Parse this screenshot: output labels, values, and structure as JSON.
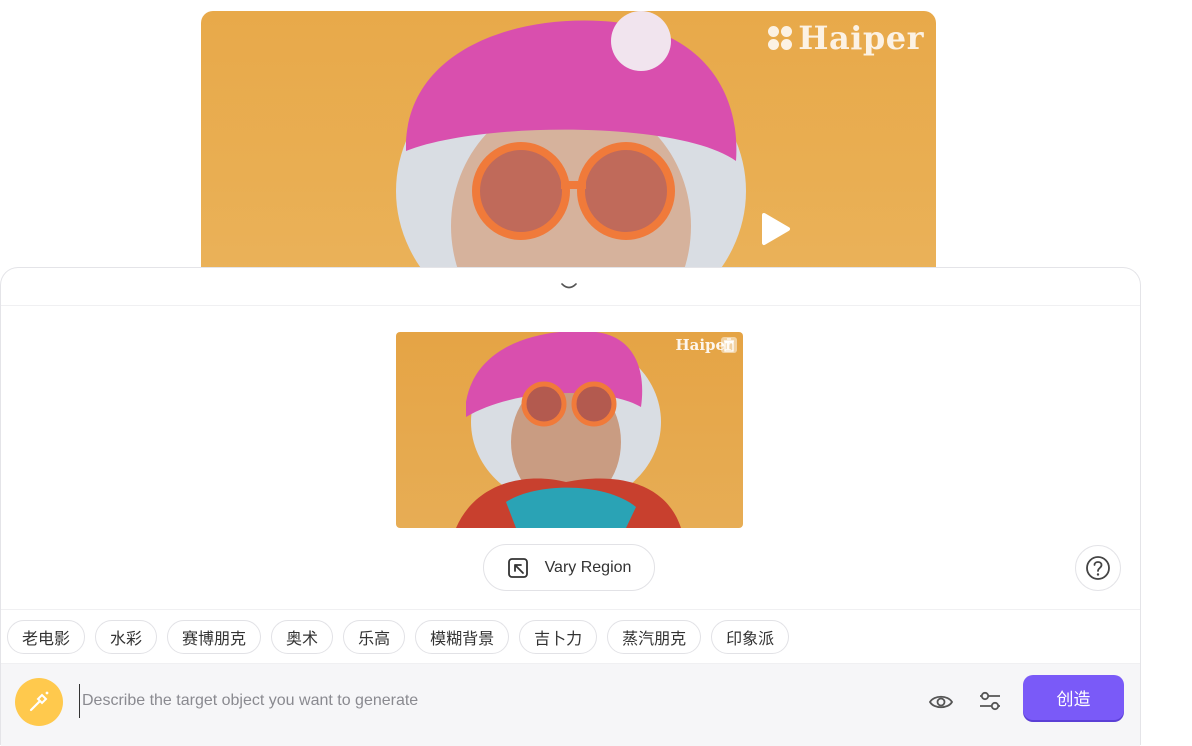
{
  "preview": {
    "watermark": "Haiper",
    "play_icon": "play-icon"
  },
  "panel": {
    "collapse_icon": "chevron-down-icon",
    "thumbnail_watermark": "Haiper",
    "thumbnail_delete_icon": "trash-icon",
    "vary_region_label": "Vary Region",
    "vary_region_icon": "region-select-icon",
    "help_icon": "question-icon"
  },
  "styles": [
    {
      "label": "老电影"
    },
    {
      "label": "水彩"
    },
    {
      "label": "赛博朋克"
    },
    {
      "label": "奥术"
    },
    {
      "label": "乐高"
    },
    {
      "label": "模糊背景"
    },
    {
      "label": "吉卜力"
    },
    {
      "label": "蒸汽朋克"
    },
    {
      "label": "印象派"
    }
  ],
  "input": {
    "placeholder": "Describe the target object you want to generate",
    "value": "",
    "magic_icon": "magic-wand-icon",
    "eye_icon": "eye-icon",
    "settings_icon": "sliders-icon",
    "create_label": "创造"
  },
  "colors": {
    "accent": "#7a5af8",
    "magic": "#ffc94d",
    "background_orange": "#e8a94a"
  }
}
